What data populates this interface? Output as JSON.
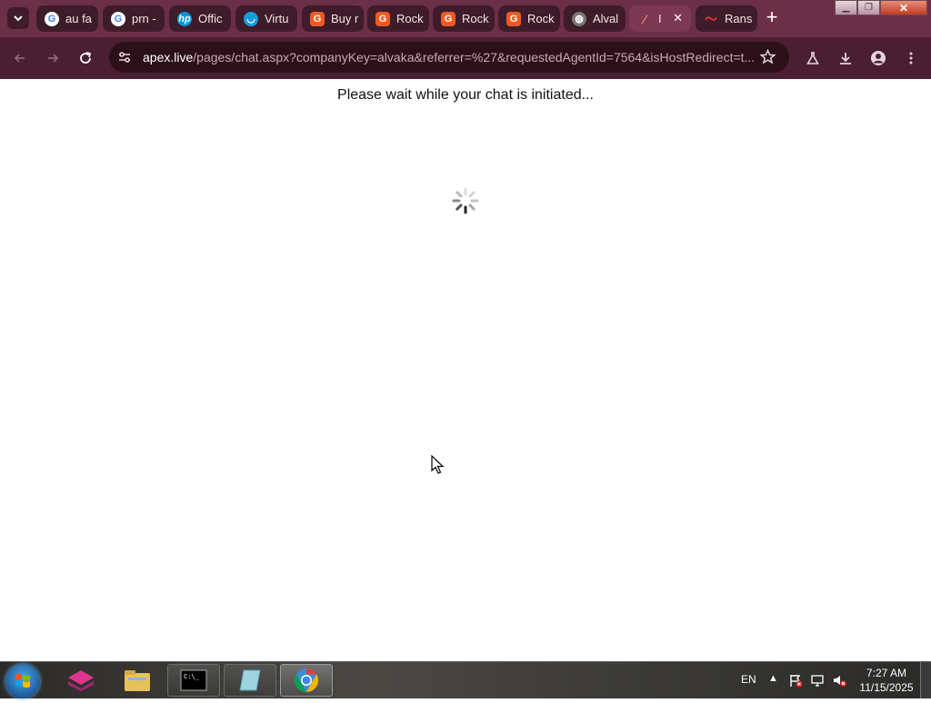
{
  "tabs": [
    {
      "label": "au fa",
      "favicon": "google-icon",
      "active": false
    },
    {
      "label": "prn -",
      "favicon": "google-icon",
      "active": false
    },
    {
      "label": "Offic",
      "favicon": "hp-icon",
      "active": false
    },
    {
      "label": "Virtu",
      "favicon": "virtual-icon",
      "active": false
    },
    {
      "label": "Buy r",
      "favicon": "g2-icon",
      "active": false
    },
    {
      "label": "Rock",
      "favicon": "g2-icon",
      "active": false
    },
    {
      "label": "Rock",
      "favicon": "g2-icon",
      "active": false
    },
    {
      "label": "Rock",
      "favicon": "g2-icon",
      "active": false
    },
    {
      "label": "Alval",
      "favicon": "globe-icon",
      "active": false
    },
    {
      "label": "I",
      "favicon": "apex-icon",
      "active": true
    },
    {
      "label": "Rans",
      "favicon": "rans-icon",
      "active": false
    }
  ],
  "address_bar": {
    "domain": "apex.live",
    "path": "/pages/chat.aspx?companyKey=alvaka&referrer=%27&requestedAgentId=7564&isHostRedirect=t..."
  },
  "page": {
    "message": "Please wait while your chat is initiated..."
  },
  "taskbar": {
    "language": "EN",
    "time": "7:27 AM",
    "date": "11/15/2025"
  },
  "colors": {
    "tabbar": "#6b2f46",
    "toolbar": "#4a1f31",
    "omnibox": "#2c1019",
    "google_g": "#ea4335",
    "g2_orange": "#ef5a24",
    "hp_blue": "#0096d6"
  }
}
